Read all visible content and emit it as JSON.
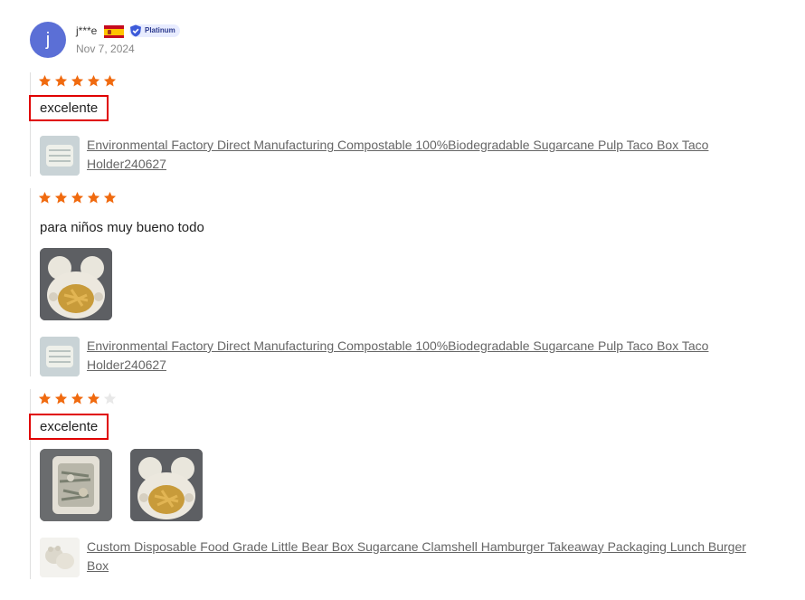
{
  "user": {
    "avatar_letter": "j",
    "name": "j***e",
    "country_flag": "spain-flag",
    "badge": "Platinum",
    "date": "Nov 7, 2024"
  },
  "colors": {
    "star": "#f06a0f",
    "star_empty": "#e8e8e8",
    "highlight": "#e00000",
    "avatar": "#5b6fd6"
  },
  "reviews": [
    {
      "rating": 5,
      "text": "excelente",
      "photos": [],
      "product": "Environmental Factory Direct Manufacturing Compostable 100%Biodegradable Sugarcane Pulp Taco Box Taco Holder240627"
    },
    {
      "rating": 5,
      "text": "para niños muy bueno todo",
      "photos": [
        "bear-box-fries-photo"
      ],
      "product": "Environmental Factory Direct Manufacturing Compostable 100%Biodegradable Sugarcane Pulp Taco Box Taco Holder240627"
    },
    {
      "rating": 4,
      "text": "excelente",
      "photos": [
        "takeaway-box-food-photo",
        "bear-box-fries-photo"
      ],
      "product": "Custom Disposable Food Grade Little Bear Box Sugarcane Clamshell Hamburger Takeaway Packaging Lunch Burger Box"
    }
  ]
}
